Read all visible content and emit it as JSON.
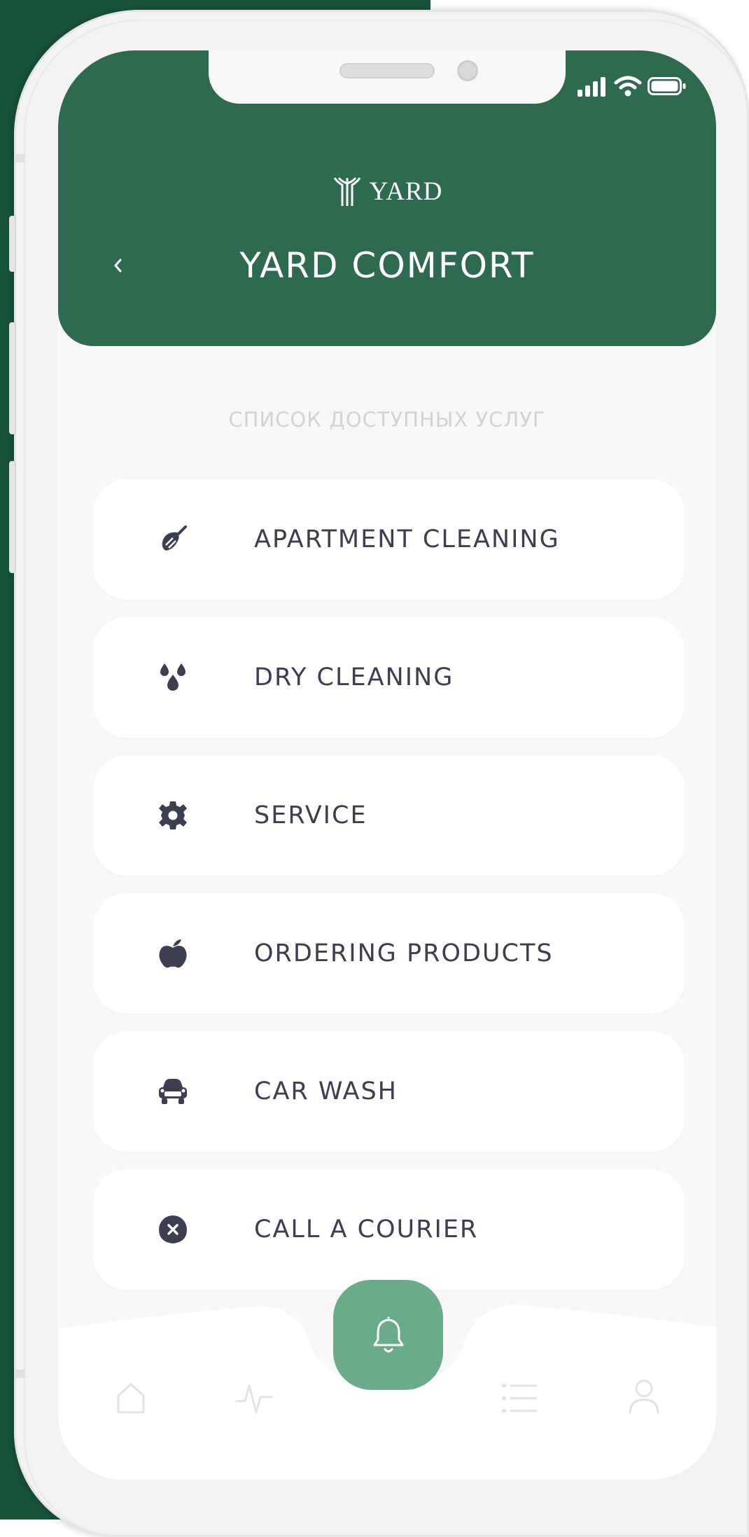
{
  "app": {
    "brand_name": "YARD",
    "title": "YARD COMFORT",
    "back_icon": "chevron-left-icon"
  },
  "section": {
    "title": "СПИСОК ДОСТУПНЫХ УСЛУГ"
  },
  "services": [
    {
      "label": "APARTMENT CLEANING",
      "icon": "broom-icon"
    },
    {
      "label": "DRY CLEANING",
      "icon": "drops-icon"
    },
    {
      "label": "SERVICE",
      "icon": "gear-icon"
    },
    {
      "label": "ORDERING PRODUCTS",
      "icon": "apple-icon"
    },
    {
      "label": "CAR WASH",
      "icon": "car-icon"
    },
    {
      "label": "CALL A COURIER",
      "icon": "location-pin-icon"
    }
  ],
  "nav": {
    "items": [
      "home-icon",
      "activity-icon",
      "bell-icon",
      "list-icon",
      "user-icon"
    ]
  },
  "colors": {
    "header": "#2e6a4e",
    "background_left": "#18533a",
    "fab": "#6aab8a",
    "text": "#3b3f50",
    "muted": "#d3d3d3"
  }
}
